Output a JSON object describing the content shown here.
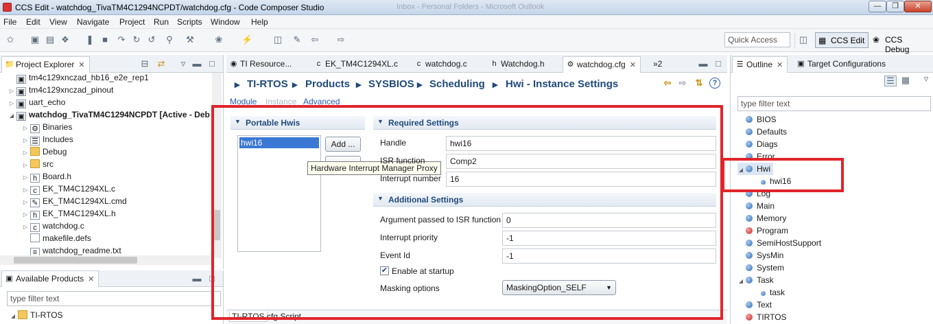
{
  "window": {
    "title": "CCS Edit - watchdog_TivaTM4C1294NCPDT/watchdog.cfg - Code Composer Studio",
    "ghost_left": "Inbox - Personal Folders - Microsoft Outlook",
    "controls": [
      "—",
      "❐",
      "✕"
    ]
  },
  "menu": [
    "File",
    "Edit",
    "View",
    "Navigate",
    "Project",
    "Run",
    "Scripts",
    "Window",
    "Help"
  ],
  "toolbar": {
    "quick_access_placeholder": "Quick Access",
    "perspectives": [
      {
        "label": "CCS Edit",
        "active": true
      },
      {
        "label": "CCS Debug",
        "active": false
      }
    ]
  },
  "project_explorer": {
    "tab_label": "Project Explorer",
    "items": [
      {
        "label": "tm4c129xnczad_hb16_e2e_rep1",
        "icon": "project-icon",
        "depth": 0,
        "twisty": ""
      },
      {
        "label": "tm4c129xnczad_pinout",
        "icon": "project-icon",
        "depth": 0,
        "twisty": "▷"
      },
      {
        "label": "uart_echo",
        "icon": "project-icon",
        "depth": 0,
        "twisty": "▷"
      },
      {
        "label": "watchdog_TivaTM4C1294NCPDT  [Active - Deb",
        "icon": "project-icon",
        "depth": 0,
        "twisty": "◢",
        "bold": true
      },
      {
        "label": "Binaries",
        "icon": "binaries-icon",
        "depth": 1,
        "twisty": "▷"
      },
      {
        "label": "Includes",
        "icon": "includes-icon",
        "depth": 1,
        "twisty": "▷"
      },
      {
        "label": "Debug",
        "icon": "folder-icon",
        "depth": 1,
        "twisty": "▷"
      },
      {
        "label": "src",
        "icon": "folder-icon",
        "depth": 1,
        "twisty": "▷"
      },
      {
        "label": "Board.h",
        "icon": "header-file-icon",
        "depth": 1,
        "twisty": "▷"
      },
      {
        "label": "EK_TM4C1294XL.c",
        "icon": "c-file-icon",
        "depth": 1,
        "twisty": "▷"
      },
      {
        "label": "EK_TM4C1294XL.cmd",
        "icon": "cmd-file-icon",
        "depth": 1,
        "twisty": "▷"
      },
      {
        "label": "EK_TM4C1294XL.h",
        "icon": "header-file-icon",
        "depth": 1,
        "twisty": "▷"
      },
      {
        "label": "watchdog.c",
        "icon": "c-file-icon",
        "depth": 1,
        "twisty": "▷"
      },
      {
        "label": "makefile.defs",
        "icon": "file-icon",
        "depth": 1,
        "twisty": ""
      },
      {
        "label": "watchdog_readme.txt",
        "icon": "text-file-icon",
        "depth": 1,
        "twisty": ""
      }
    ]
  },
  "available_products": {
    "tab_label": "Available Products",
    "filter_placeholder": "type filter text",
    "items": [
      {
        "label": "TI-RTOS",
        "twisty": "◢"
      }
    ]
  },
  "editor": {
    "tabs": [
      {
        "label": "TI Resource...",
        "icon": "globe-icon"
      },
      {
        "label": "EK_TM4C1294XL.c",
        "icon": "c-file-icon"
      },
      {
        "label": "watchdog.c",
        "icon": "c-file-icon"
      },
      {
        "label": "Watchdog.h",
        "icon": "header-file-icon"
      },
      {
        "label": "watchdog.cfg",
        "icon": "cfg-file-icon",
        "selected": true
      }
    ],
    "overflow": "»2",
    "breadcrumb": [
      "TI-RTOS",
      "Products",
      "SYSBIOS",
      "Scheduling",
      "Hwi - Instance Settings"
    ],
    "sep": "▸",
    "sublinks": [
      "Module",
      "Instance",
      "Advanced"
    ],
    "portable": {
      "title": "Portable Hwis",
      "items": [
        "hwi16"
      ],
      "add_label": "Add ...",
      "tooltip": "Hardware Interrupt Manager Proxy"
    },
    "required": {
      "title": "Required Settings",
      "handle_label": "Handle",
      "handle_value": "hwi16",
      "isr_label": "ISR function",
      "isr_value": "Comp2",
      "intnum_label": "Interrupt number",
      "intnum_value": "16"
    },
    "additional": {
      "title": "Additional Settings",
      "arg_label": "Argument passed to ISR function",
      "arg_value": "0",
      "priority_label": "Interrupt priority",
      "priority_value": "-1",
      "eventid_label": "Event Id",
      "eventid_value": "-1",
      "enable_label": "Enable at startup",
      "enable_checked": true,
      "masking_label": "Masking options",
      "masking_value": "MaskingOption_SELF"
    },
    "bottom_tabs": [
      "TI-RTOS",
      "cfg Script"
    ]
  },
  "outline": {
    "tab_label": "Outline",
    "target_tab_label": "Target Configurations",
    "filter_placeholder": "type filter text",
    "items": [
      {
        "label": "BIOS",
        "depth": 0,
        "color": "blue"
      },
      {
        "label": "Defaults",
        "depth": 0,
        "color": "blue"
      },
      {
        "label": "Diags",
        "depth": 0,
        "color": "blue"
      },
      {
        "label": "Error",
        "depth": 0,
        "color": "blue"
      },
      {
        "label": "Hwi",
        "depth": 0,
        "color": "blue",
        "expanded": true,
        "selected": true
      },
      {
        "label": "hwi16",
        "depth": 1,
        "color": "blue"
      },
      {
        "label": "Log",
        "depth": 0,
        "color": "blue"
      },
      {
        "label": "Main",
        "depth": 0,
        "color": "blue"
      },
      {
        "label": "Memory",
        "depth": 0,
        "color": "blue"
      },
      {
        "label": "Program",
        "depth": 0,
        "color": "red"
      },
      {
        "label": "SemiHostSupport",
        "depth": 0,
        "color": "blue"
      },
      {
        "label": "SysMin",
        "depth": 0,
        "color": "blue"
      },
      {
        "label": "System",
        "depth": 0,
        "color": "blue"
      },
      {
        "label": "Task",
        "depth": 0,
        "color": "blue",
        "expanded": true
      },
      {
        "label": "task",
        "depth": 1,
        "color": "blue"
      },
      {
        "label": "Text",
        "depth": 0,
        "color": "blue"
      },
      {
        "label": "TIRTOS",
        "depth": 0,
        "color": "red"
      }
    ]
  },
  "colors": {
    "highlight_box": "#e0242b",
    "link": "#2a5bb5",
    "heading": "#1f4a7a"
  }
}
